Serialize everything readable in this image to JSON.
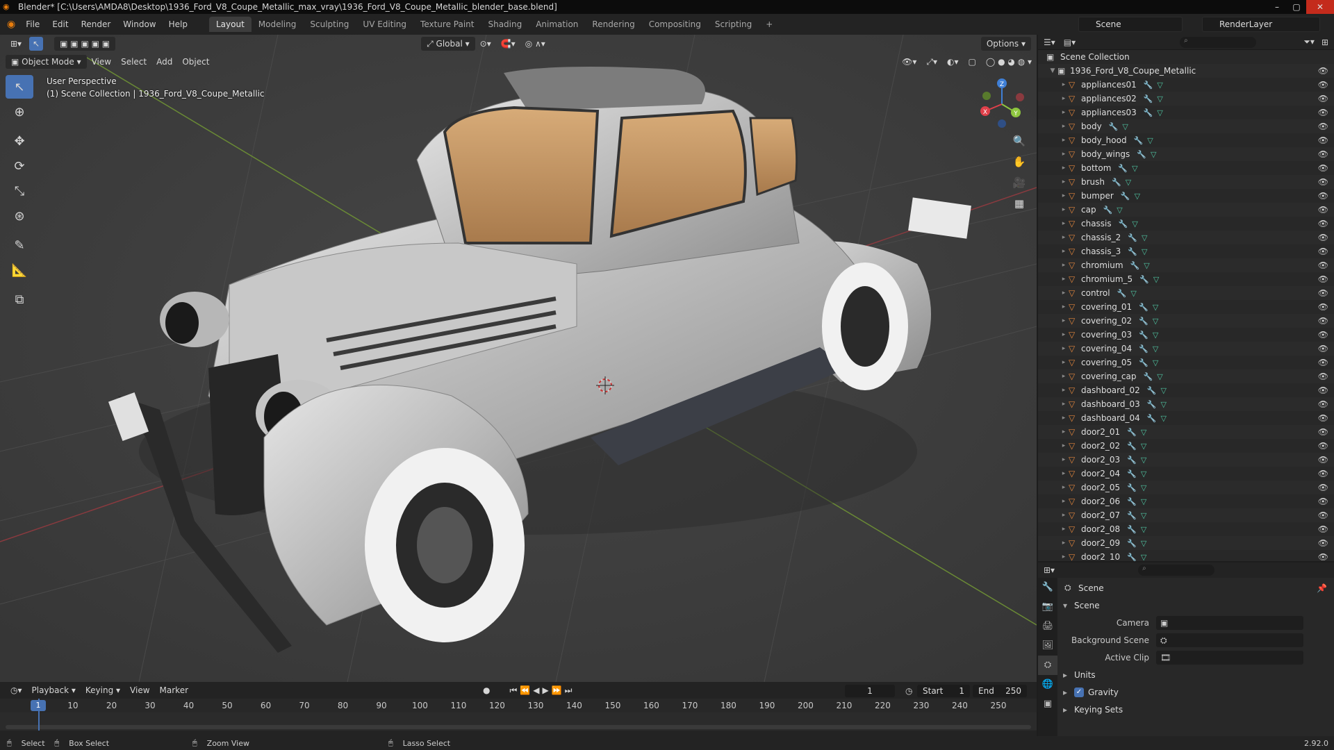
{
  "window": {
    "title": "Blender* [C:\\Users\\AMDA8\\Desktop\\1936_Ford_V8_Coupe_Metallic_max_vray\\1936_Ford_V8_Coupe_Metallic_blender_base.blend]"
  },
  "menu": [
    "File",
    "Edit",
    "Render",
    "Window",
    "Help"
  ],
  "workspaces": [
    "Layout",
    "Modeling",
    "Sculpting",
    "UV Editing",
    "Texture Paint",
    "Shading",
    "Animation",
    "Rendering",
    "Compositing",
    "Scripting"
  ],
  "active_workspace": "Layout",
  "scene": "Scene",
  "render_layer": "RenderLayer",
  "viewport": {
    "transform_orientation": "Global",
    "options_label": "Options",
    "mode": "Object Mode",
    "menus": [
      "View",
      "Select",
      "Add",
      "Object"
    ],
    "perspective": "User Perspective",
    "collection_info": "(1) Scene Collection | 1936_Ford_V8_Coupe_Metallic",
    "gizmo": {
      "x": "X",
      "y": "Y",
      "z": "Z"
    },
    "colors": {
      "x": "#e0404a",
      "y": "#8ec63f",
      "z": "#3f7fd6"
    }
  },
  "outliner": {
    "root": "Scene Collection",
    "collection": "1936_Ford_V8_Coupe_Metallic",
    "objects": [
      "appliances01",
      "appliances02",
      "appliances03",
      "body",
      "body_hood",
      "body_wings",
      "bottom",
      "brush",
      "bumper",
      "cap",
      "chassis",
      "chassis_2",
      "chassis_3",
      "chromium",
      "chromium_5",
      "control",
      "covering_01",
      "covering_02",
      "covering_03",
      "covering_04",
      "covering_05",
      "covering_cap",
      "dashboard_02",
      "dashboard_03",
      "dashboard_04",
      "door2_01",
      "door2_02",
      "door2_03",
      "door2_04",
      "door2_05",
      "door2_06",
      "door2_07",
      "door2_08",
      "door2_09",
      "door2_10"
    ]
  },
  "properties": {
    "context": "Scene",
    "panel": "Scene",
    "camera_label": "Camera",
    "background_scene_label": "Background Scene",
    "active_clip_label": "Active Clip",
    "units_label": "Units",
    "gravity_label": "Gravity",
    "gravity_checked": true,
    "keying_sets_label": "Keying Sets"
  },
  "timeline": {
    "menus": [
      "Playback",
      "Keying",
      "View",
      "Marker"
    ],
    "current_frame": "1",
    "start_label": "Start",
    "start": "1",
    "end_label": "End",
    "end": "250",
    "ticks": [
      "10",
      "20",
      "30",
      "40",
      "50",
      "60",
      "70",
      "80",
      "90",
      "100",
      "110",
      "120",
      "130",
      "140",
      "150",
      "160",
      "170",
      "180",
      "190",
      "200",
      "210",
      "220",
      "230",
      "240",
      "250"
    ]
  },
  "statusbar": {
    "select": "Select",
    "box_select": "Box Select",
    "zoom_view": "Zoom View",
    "lasso_select": "Lasso Select",
    "version": "2.92.0"
  }
}
